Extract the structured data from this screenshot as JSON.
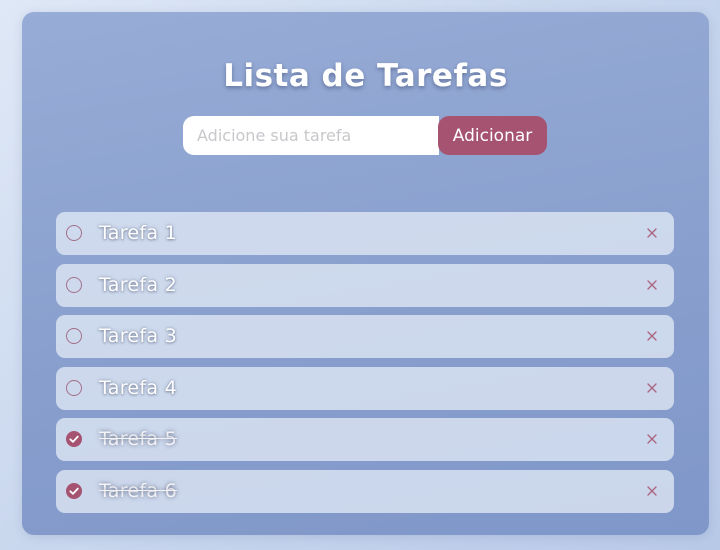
{
  "app": {
    "title": "Lista de Tarefas"
  },
  "input": {
    "placeholder": "Adicione sua tarefa",
    "value": "",
    "add_label": "Adicionar"
  },
  "tasks": [
    {
      "label": "Tarefa 1",
      "done": false
    },
    {
      "label": "Tarefa 2",
      "done": false
    },
    {
      "label": "Tarefa 3",
      "done": false
    },
    {
      "label": "Tarefa 4",
      "done": false
    },
    {
      "label": "Tarefa 5",
      "done": true
    },
    {
      "label": "Tarefa 6",
      "done": true
    }
  ],
  "icons": {
    "unchecked": "circle-icon",
    "checked": "check-circle-icon",
    "delete": "close-icon"
  },
  "colors": {
    "accent": "#a55370",
    "card_top": "#97acd6",
    "card_bottom": "#7f97c9",
    "item_bg": "#e8eef8"
  }
}
